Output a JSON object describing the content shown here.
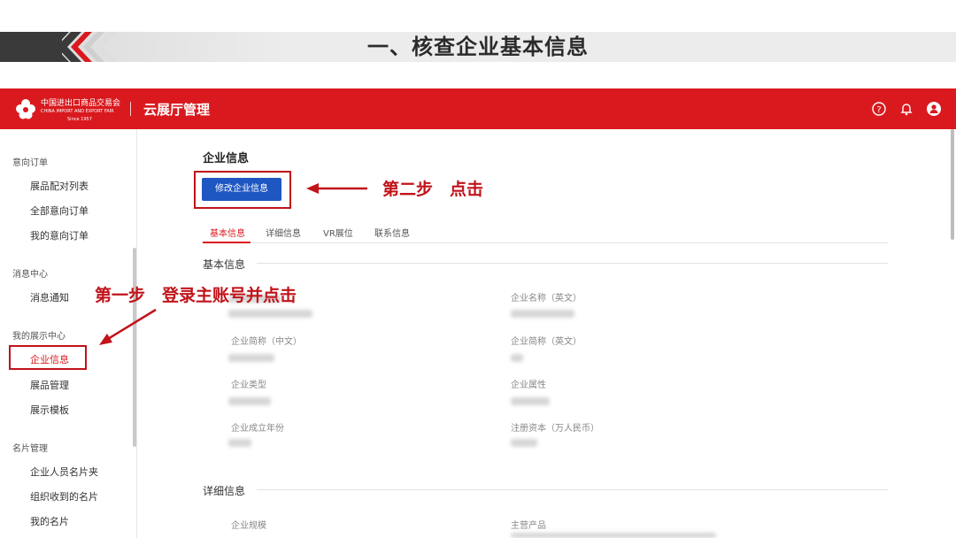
{
  "slide": {
    "title": "一、核查企业基本信息"
  },
  "header": {
    "logo": {
      "cn": "中国进出口商品交易会",
      "en": "CHINA IMPORT AND EXPORT FAIR",
      "since": "Since 1957"
    },
    "title": "云展厅管理",
    "icons": [
      "help-icon",
      "bell-icon",
      "user-icon"
    ]
  },
  "sidebar": {
    "groups": [
      {
        "label": "意向订单",
        "items": [
          "展品配对列表",
          "全部意向订单",
          "我的意向订单"
        ]
      },
      {
        "label": "消息中心",
        "items": [
          "消息通知"
        ]
      },
      {
        "label": "我的展示中心",
        "items": [
          "企业信息",
          "展品管理",
          "展示模板"
        ]
      },
      {
        "label": "名片管理",
        "items": [
          "企业人员名片夹",
          "组织收到的名片",
          "我的名片"
        ]
      }
    ],
    "active_item": "企业信息"
  },
  "main": {
    "section_title": "企业信息",
    "edit_button": "修改企业信息",
    "tabs": [
      "基本信息",
      "详细信息",
      "VR展位",
      "联系信息"
    ],
    "active_tab": "基本信息",
    "basic": {
      "title": "基本信息",
      "fields": [
        {
          "label": "企业名称（英文）"
        },
        {
          "label": "企业简称（中文）"
        },
        {
          "label": "企业简称（英文）"
        },
        {
          "label": "企业类型"
        },
        {
          "label": "企业属性"
        },
        {
          "label": "企业成立年份"
        },
        {
          "label": "注册资本（万人民币）"
        }
      ]
    },
    "detail": {
      "title": "详细信息",
      "fields": [
        {
          "label": "企业规模"
        },
        {
          "label": "主营产品"
        }
      ]
    }
  },
  "annotations": {
    "step1": "第一步　登录主账号并点击",
    "step2": "第二步　点击"
  },
  "colors": {
    "brand_red": "#d9191e",
    "annotation_red": "#c1131a",
    "button_blue": "#1f57c2"
  }
}
